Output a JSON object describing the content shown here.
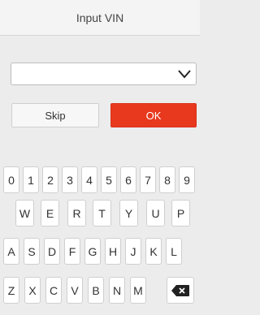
{
  "dialog": {
    "title": "Input VIN",
    "vin_input": {
      "value": "",
      "placeholder": ""
    },
    "skip_label": "Skip",
    "ok_label": "OK"
  },
  "keyboard": {
    "row1": [
      "0",
      "1",
      "2",
      "3",
      "4",
      "5",
      "6",
      "7",
      "8",
      "9"
    ],
    "row2": [
      "W",
      "E",
      "R",
      "T",
      "Y",
      "U",
      "P"
    ],
    "row3": [
      "A",
      "S",
      "D",
      "F",
      "G",
      "H",
      "J",
      "K",
      "L"
    ],
    "row4": [
      "Z",
      "X",
      "C",
      "V",
      "B",
      "N",
      "M"
    ],
    "backspace_icon": "backspace-icon"
  },
  "colors": {
    "accent": "#e8391f",
    "background": "#ececec"
  }
}
